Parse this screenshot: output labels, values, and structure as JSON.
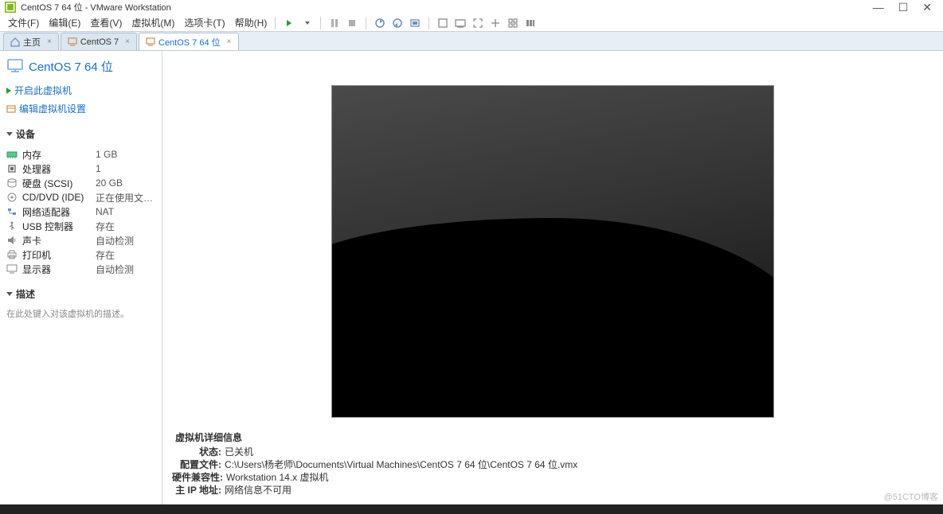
{
  "titlebar": {
    "icon_name": "vmware-icon",
    "text": "CentOS 7 64 位 - VMware Workstation"
  },
  "window_controls": {
    "min": "—",
    "max": "☐",
    "close": "✕"
  },
  "menubar": {
    "items": [
      {
        "label": "文件(F)"
      },
      {
        "label": "编辑(E)"
      },
      {
        "label": "查看(V)"
      },
      {
        "label": "虚拟机(M)"
      },
      {
        "label": "选项卡(T)"
      },
      {
        "label": "帮助(H)"
      }
    ]
  },
  "toolbar": {
    "icons": [
      "power-on",
      "dropdown",
      "suspend",
      "shutdown",
      "snapshot",
      "snapshot-revert",
      "snapshot-manager",
      "unity",
      "fullscreen",
      "stretch",
      "cycle",
      "library"
    ]
  },
  "tabs": [
    {
      "label": "主页",
      "icon": "home-icon",
      "active": false
    },
    {
      "label": "CentOS 7",
      "icon": "vm-icon",
      "active": false
    },
    {
      "label": "CentOS 7 64 位",
      "icon": "vm-icon",
      "active": true
    }
  ],
  "vm": {
    "title": "CentOS 7 64 位",
    "actions": {
      "power_on": "开启此虚拟机",
      "edit_settings": "编辑虚拟机设置"
    },
    "sections": {
      "devices_header": "设备",
      "description_header": "描述",
      "description_placeholder": "在此处键入对该虚拟机的描述。"
    },
    "devices": [
      {
        "icon": "memory-icon",
        "label": "内存",
        "value": "1 GB"
      },
      {
        "icon": "cpu-icon",
        "label": "处理器",
        "value": "1"
      },
      {
        "icon": "hdd-icon",
        "label": "硬盘 (SCSI)",
        "value": "20 GB"
      },
      {
        "icon": "cd-icon",
        "label": "CD/DVD (IDE)",
        "value": "正在使用文件 F..."
      },
      {
        "icon": "network-icon",
        "label": "网络适配器",
        "value": "NAT"
      },
      {
        "icon": "usb-icon",
        "label": "USB 控制器",
        "value": "存在"
      },
      {
        "icon": "sound-icon",
        "label": "声卡",
        "value": "自动检测"
      },
      {
        "icon": "printer-icon",
        "label": "打印机",
        "value": "存在"
      },
      {
        "icon": "display-icon",
        "label": "显示器",
        "value": "自动检测"
      }
    ],
    "details": {
      "header": "虚拟机详细信息",
      "rows": [
        {
          "label": "状态:",
          "value": "已关机"
        },
        {
          "label": "配置文件:",
          "value": "C:\\Users\\杨老师\\Documents\\Virtual Machines\\CentOS 7 64 位\\CentOS 7 64 位.vmx"
        },
        {
          "label": "硬件兼容性:",
          "value": "Workstation 14.x 虚拟机"
        },
        {
          "label": "主 IP 地址:",
          "value": "网络信息不可用"
        }
      ]
    }
  },
  "watermark": "@51CTO博客"
}
